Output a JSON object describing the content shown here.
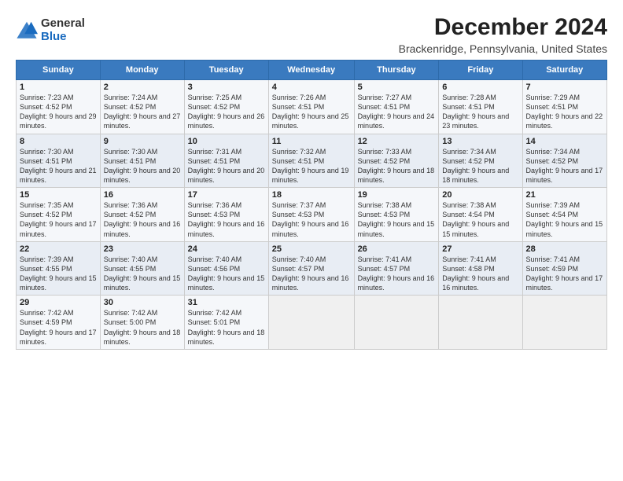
{
  "logo": {
    "general": "General",
    "blue": "Blue"
  },
  "title": "December 2024",
  "subtitle": "Brackenridge, Pennsylvania, United States",
  "days_of_week": [
    "Sunday",
    "Monday",
    "Tuesday",
    "Wednesday",
    "Thursday",
    "Friday",
    "Saturday"
  ],
  "weeks": [
    [
      {
        "num": "1",
        "sunrise": "7:23 AM",
        "sunset": "4:52 PM",
        "daylight": "9 hours and 29 minutes."
      },
      {
        "num": "2",
        "sunrise": "7:24 AM",
        "sunset": "4:52 PM",
        "daylight": "9 hours and 27 minutes."
      },
      {
        "num": "3",
        "sunrise": "7:25 AM",
        "sunset": "4:52 PM",
        "daylight": "9 hours and 26 minutes."
      },
      {
        "num": "4",
        "sunrise": "7:26 AM",
        "sunset": "4:51 PM",
        "daylight": "9 hours and 25 minutes."
      },
      {
        "num": "5",
        "sunrise": "7:27 AM",
        "sunset": "4:51 PM",
        "daylight": "9 hours and 24 minutes."
      },
      {
        "num": "6",
        "sunrise": "7:28 AM",
        "sunset": "4:51 PM",
        "daylight": "9 hours and 23 minutes."
      },
      {
        "num": "7",
        "sunrise": "7:29 AM",
        "sunset": "4:51 PM",
        "daylight": "9 hours and 22 minutes."
      }
    ],
    [
      {
        "num": "8",
        "sunrise": "7:30 AM",
        "sunset": "4:51 PM",
        "daylight": "9 hours and 21 minutes."
      },
      {
        "num": "9",
        "sunrise": "7:30 AM",
        "sunset": "4:51 PM",
        "daylight": "9 hours and 20 minutes."
      },
      {
        "num": "10",
        "sunrise": "7:31 AM",
        "sunset": "4:51 PM",
        "daylight": "9 hours and 20 minutes."
      },
      {
        "num": "11",
        "sunrise": "7:32 AM",
        "sunset": "4:51 PM",
        "daylight": "9 hours and 19 minutes."
      },
      {
        "num": "12",
        "sunrise": "7:33 AM",
        "sunset": "4:52 PM",
        "daylight": "9 hours and 18 minutes."
      },
      {
        "num": "13",
        "sunrise": "7:34 AM",
        "sunset": "4:52 PM",
        "daylight": "9 hours and 18 minutes."
      },
      {
        "num": "14",
        "sunrise": "7:34 AM",
        "sunset": "4:52 PM",
        "daylight": "9 hours and 17 minutes."
      }
    ],
    [
      {
        "num": "15",
        "sunrise": "7:35 AM",
        "sunset": "4:52 PM",
        "daylight": "9 hours and 17 minutes."
      },
      {
        "num": "16",
        "sunrise": "7:36 AM",
        "sunset": "4:52 PM",
        "daylight": "9 hours and 16 minutes."
      },
      {
        "num": "17",
        "sunrise": "7:36 AM",
        "sunset": "4:53 PM",
        "daylight": "9 hours and 16 minutes."
      },
      {
        "num": "18",
        "sunrise": "7:37 AM",
        "sunset": "4:53 PM",
        "daylight": "9 hours and 16 minutes."
      },
      {
        "num": "19",
        "sunrise": "7:38 AM",
        "sunset": "4:53 PM",
        "daylight": "9 hours and 15 minutes."
      },
      {
        "num": "20",
        "sunrise": "7:38 AM",
        "sunset": "4:54 PM",
        "daylight": "9 hours and 15 minutes."
      },
      {
        "num": "21",
        "sunrise": "7:39 AM",
        "sunset": "4:54 PM",
        "daylight": "9 hours and 15 minutes."
      }
    ],
    [
      {
        "num": "22",
        "sunrise": "7:39 AM",
        "sunset": "4:55 PM",
        "daylight": "9 hours and 15 minutes."
      },
      {
        "num": "23",
        "sunrise": "7:40 AM",
        "sunset": "4:55 PM",
        "daylight": "9 hours and 15 minutes."
      },
      {
        "num": "24",
        "sunrise": "7:40 AM",
        "sunset": "4:56 PM",
        "daylight": "9 hours and 15 minutes."
      },
      {
        "num": "25",
        "sunrise": "7:40 AM",
        "sunset": "4:57 PM",
        "daylight": "9 hours and 16 minutes."
      },
      {
        "num": "26",
        "sunrise": "7:41 AM",
        "sunset": "4:57 PM",
        "daylight": "9 hours and 16 minutes."
      },
      {
        "num": "27",
        "sunrise": "7:41 AM",
        "sunset": "4:58 PM",
        "daylight": "9 hours and 16 minutes."
      },
      {
        "num": "28",
        "sunrise": "7:41 AM",
        "sunset": "4:59 PM",
        "daylight": "9 hours and 17 minutes."
      }
    ],
    [
      {
        "num": "29",
        "sunrise": "7:42 AM",
        "sunset": "4:59 PM",
        "daylight": "9 hours and 17 minutes."
      },
      {
        "num": "30",
        "sunrise": "7:42 AM",
        "sunset": "5:00 PM",
        "daylight": "9 hours and 18 minutes."
      },
      {
        "num": "31",
        "sunrise": "7:42 AM",
        "sunset": "5:01 PM",
        "daylight": "9 hours and 18 minutes."
      },
      null,
      null,
      null,
      null
    ]
  ]
}
